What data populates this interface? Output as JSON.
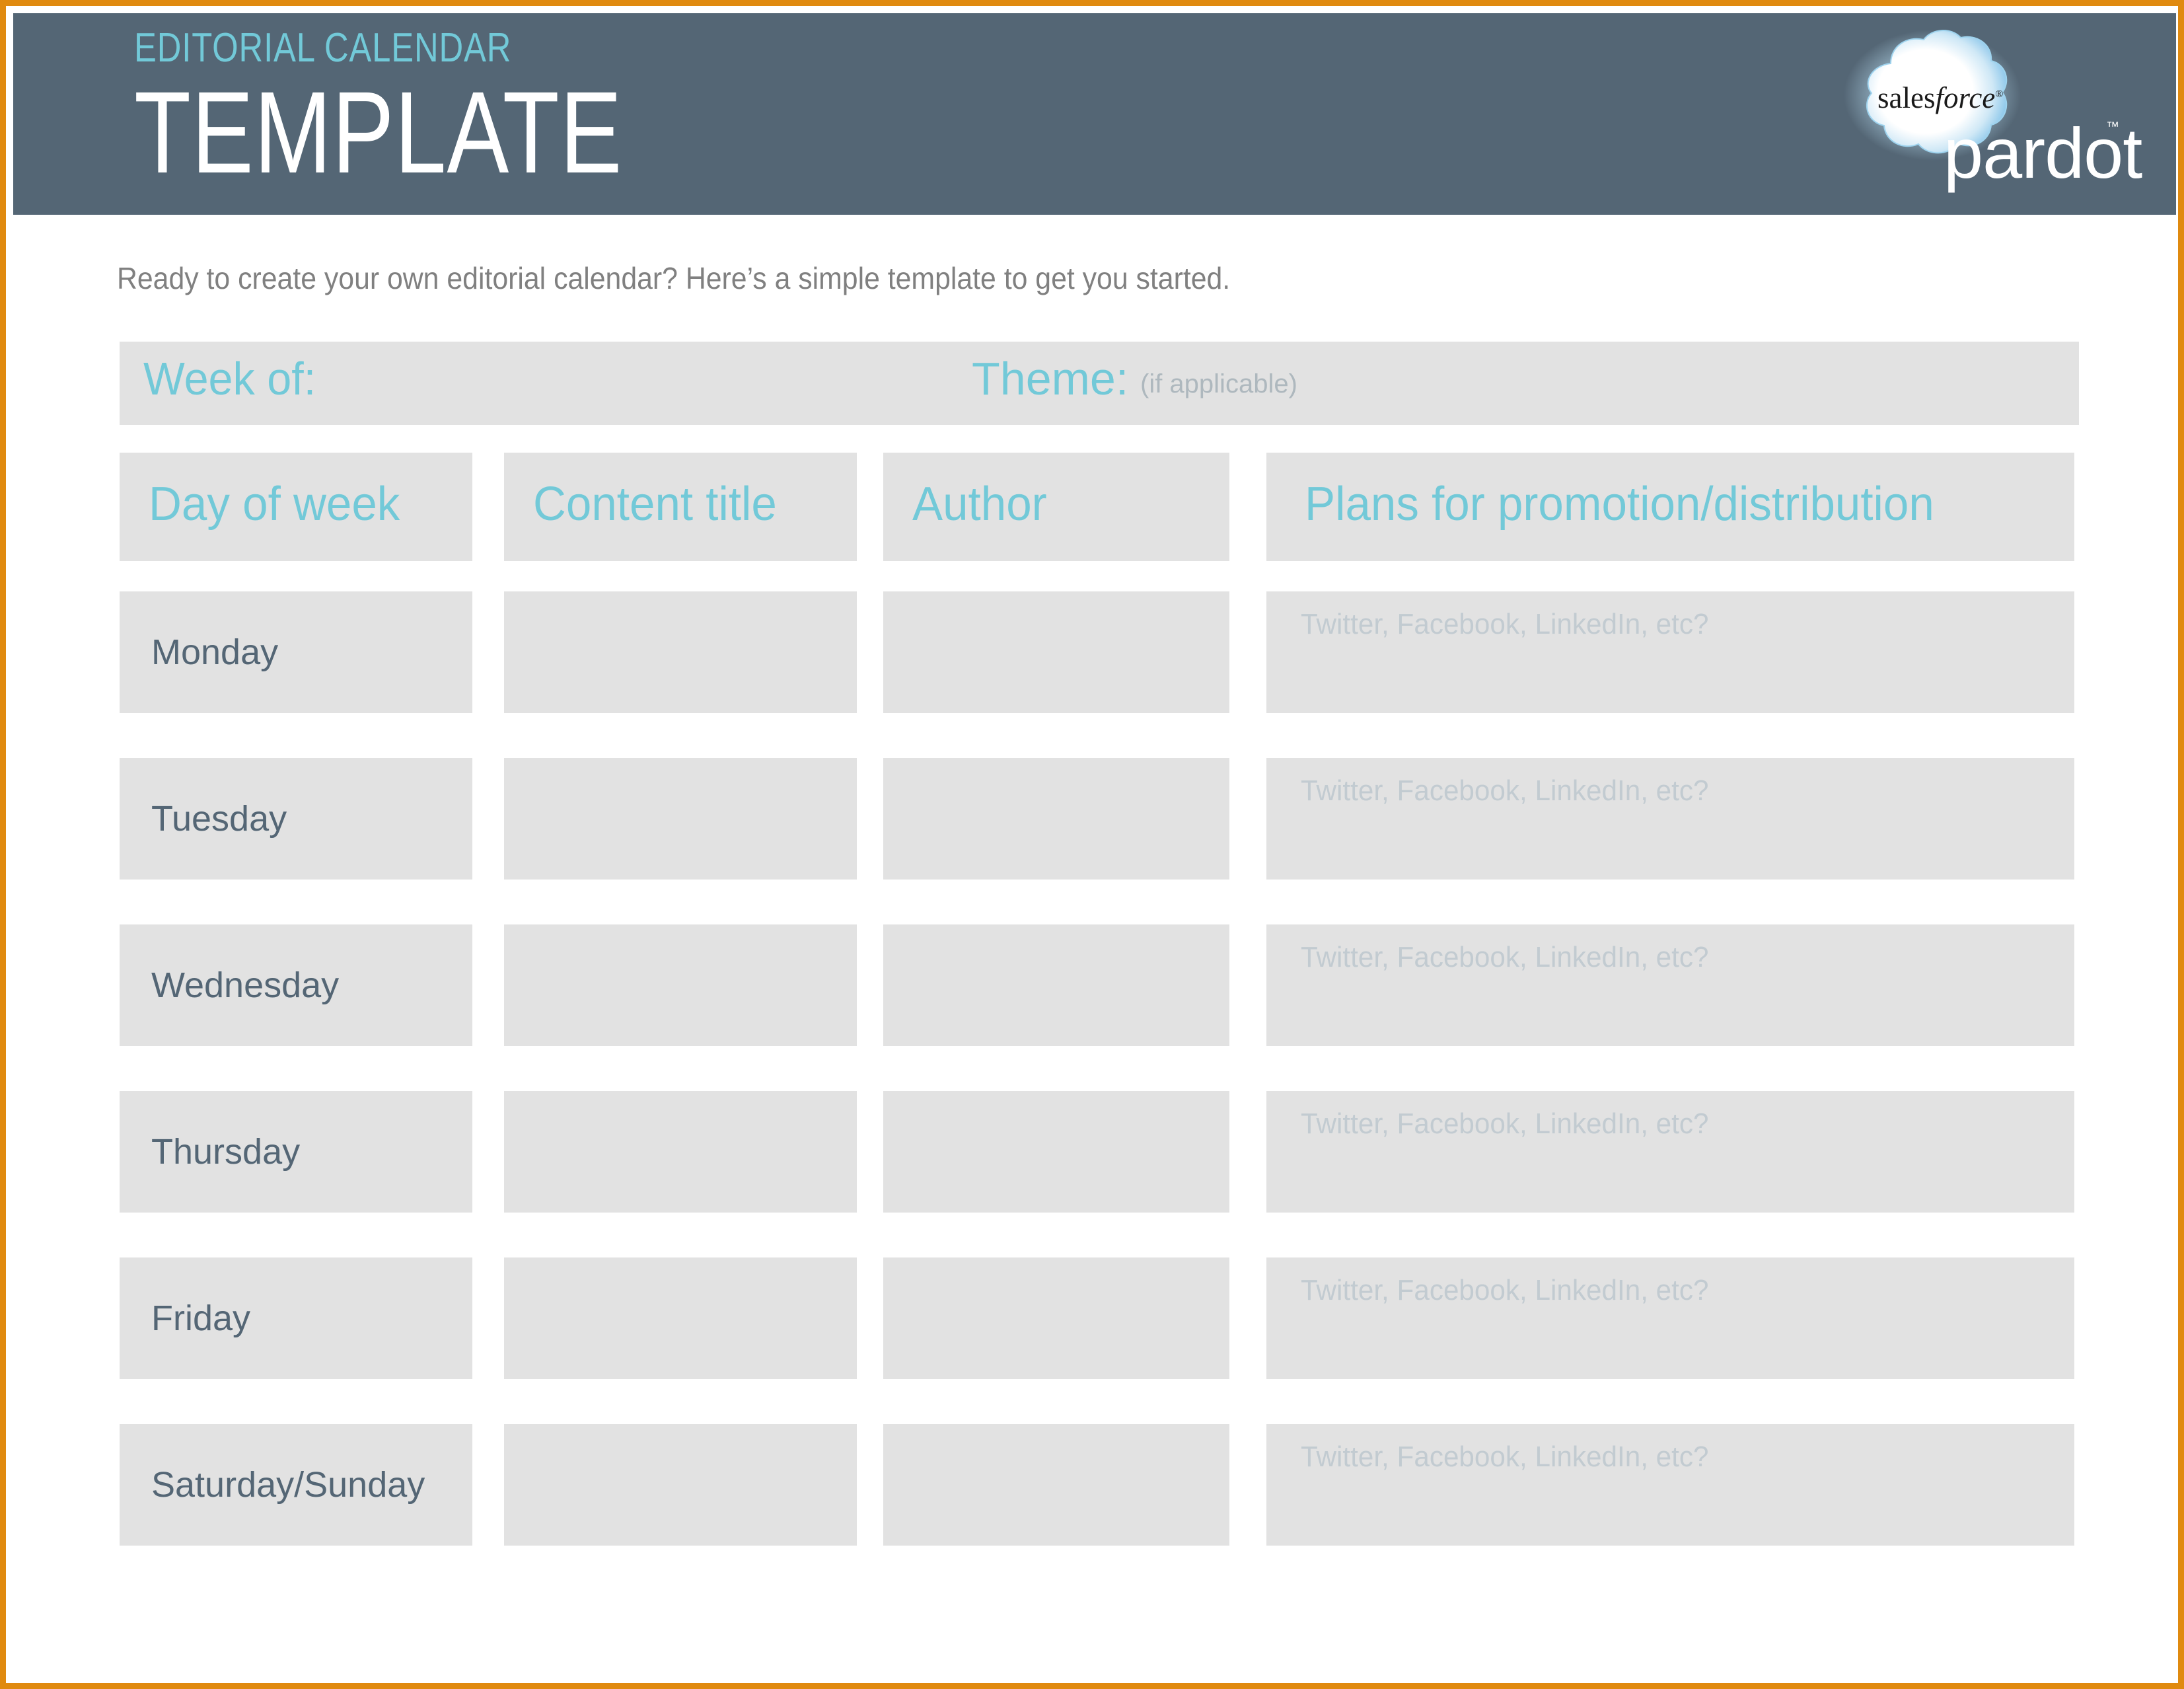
{
  "brand": {
    "accent_teal": "#72C9D8",
    "header_slate": "#546675",
    "border_orange": "#E08A0F",
    "cell_gray": "#E2E2E2",
    "placeholder_gray": "#C2CBD1"
  },
  "header": {
    "eyebrow": "EDITORIAL CALENDAR",
    "title": "TEMPLATE",
    "logo": {
      "cloud_word_part1": "sales",
      "cloud_word_part2": "force",
      "registered_mark": "®",
      "product": "pardot",
      "trademark": "™"
    }
  },
  "intro": {
    "text": "Ready to create your own editorial calendar? Here’s a simple template to get you started."
  },
  "week_band": {
    "week_label": "Week of:",
    "theme_label": "Theme:",
    "theme_note": "(if applicable)"
  },
  "table": {
    "headers": [
      "Day of week",
      "Content title",
      "Author",
      "Plans for promotion/distribution"
    ],
    "promotion_placeholder": "Twitter, Facebook, LinkedIn, etc?",
    "rows": [
      {
        "day": "Monday",
        "content_title": "",
        "author": "",
        "promotion": "Twitter, Facebook, LinkedIn, etc?"
      },
      {
        "day": "Tuesday",
        "content_title": "",
        "author": "",
        "promotion": "Twitter, Facebook, LinkedIn, etc?"
      },
      {
        "day": "Wednesday",
        "content_title": "",
        "author": "",
        "promotion": "Twitter, Facebook, LinkedIn, etc?"
      },
      {
        "day": "Thursday",
        "content_title": "",
        "author": "",
        "promotion": "Twitter, Facebook, LinkedIn, etc?"
      },
      {
        "day": "Friday",
        "content_title": "",
        "author": "",
        "promotion": "Twitter, Facebook, LinkedIn, etc?"
      },
      {
        "day": "Saturday/Sunday",
        "content_title": "",
        "author": "",
        "promotion": "Twitter, Facebook, LinkedIn, etc?"
      }
    ]
  }
}
